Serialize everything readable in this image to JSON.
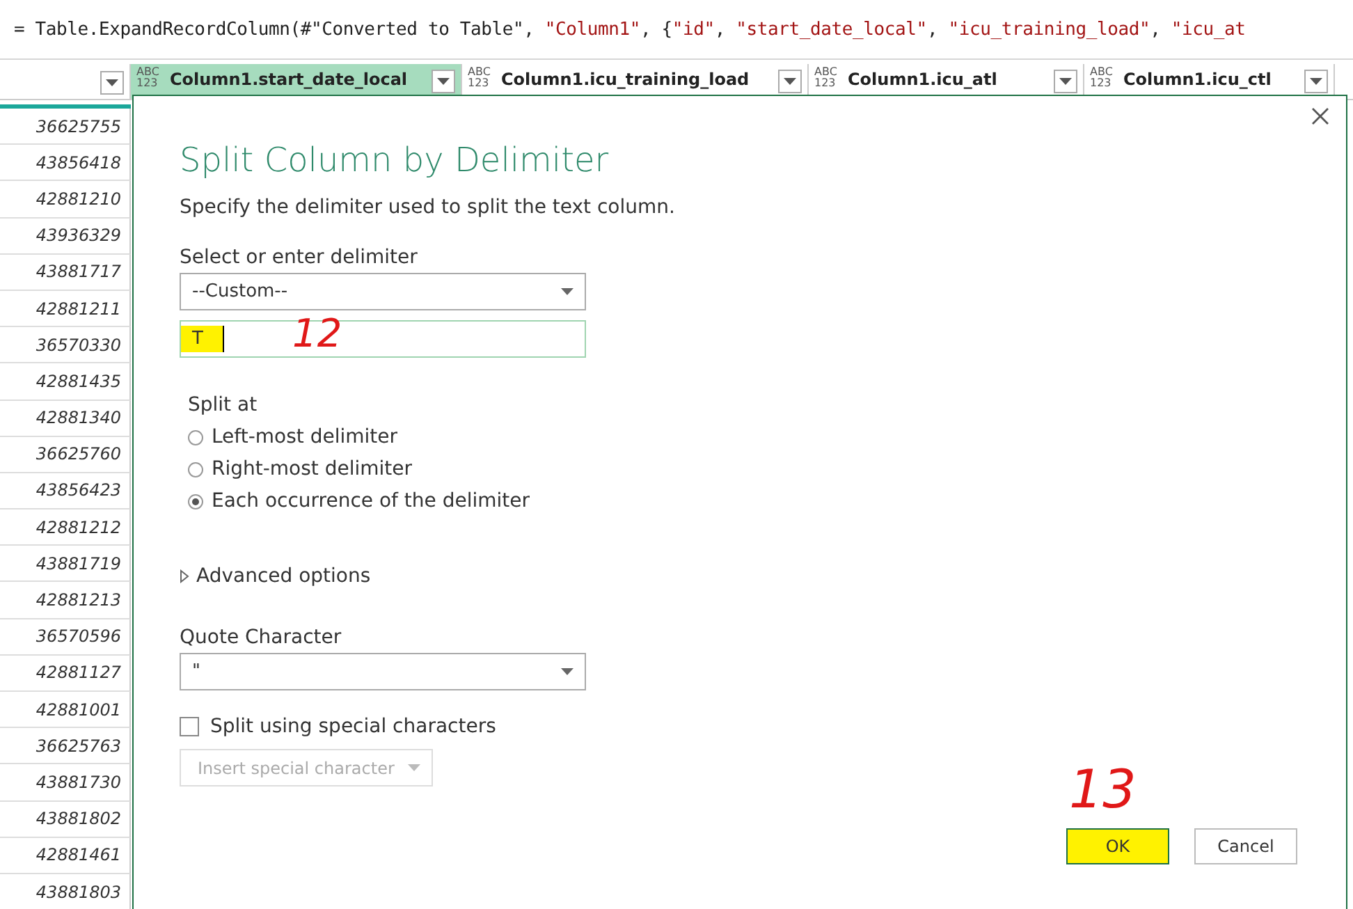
{
  "formula_bar": {
    "parts": [
      {
        "kind": "code",
        "text": "= Table.ExpandRecordColumn(#\"Converted to Table\", "
      },
      {
        "kind": "string",
        "text": "\"Column1\""
      },
      {
        "kind": "code",
        "text": ", {"
      },
      {
        "kind": "string",
        "text": "\"id\""
      },
      {
        "kind": "code",
        "text": ", "
      },
      {
        "kind": "string",
        "text": "\"start_date_local\""
      },
      {
        "kind": "code",
        "text": ", "
      },
      {
        "kind": "string",
        "text": "\"icu_training_load\""
      },
      {
        "kind": "code",
        "text": ", "
      },
      {
        "kind": "string",
        "text": "\"icu_at"
      }
    ]
  },
  "table": {
    "columns": [
      {
        "type": "ABC 123",
        "label": "Column1.start_date_local",
        "selected": true
      },
      {
        "type": "ABC 123",
        "label": "Column1.icu_training_load",
        "selected": false
      },
      {
        "type": "ABC 123",
        "label": "Column1.icu_atl",
        "selected": false
      },
      {
        "type": "ABC 123",
        "label": "Column1.icu_ctl",
        "selected": false
      }
    ],
    "id_column": [
      "36625755",
      "43856418",
      "42881210",
      "43936329",
      "43881717",
      "42881211",
      "36570330",
      "42881435",
      "42881340",
      "36625760",
      "43856423",
      "42881212",
      "43881719",
      "42881213",
      "36570596",
      "42881127",
      "42881001",
      "36625763",
      "43881730",
      "43881802",
      "42881461",
      "43881803"
    ]
  },
  "dialog": {
    "title": "Split Column by Delimiter",
    "description": "Specify the delimiter used to split the text column.",
    "delimiter_label": "Select or enter delimiter",
    "delimiter_select": "--Custom--",
    "delimiter_value": "T",
    "delimiter_highlighted": true,
    "delimiter_annotation": "12",
    "split_at_label": "Split at",
    "split_options": [
      {
        "label": "Left-most delimiter",
        "selected": false
      },
      {
        "label": "Right-most delimiter",
        "selected": false
      },
      {
        "label": "Each occurrence of the delimiter",
        "selected": true
      }
    ],
    "advanced_label": "Advanced options",
    "advanced_expanded": false,
    "quote_label": "Quote Character",
    "quote_value": "\"",
    "special_chars": {
      "label": "Split using special characters",
      "checked": false
    },
    "insert_button": {
      "label": "Insert special character",
      "disabled": true
    },
    "buttons": [
      {
        "label": "OK",
        "kind": "primary",
        "highlighted": true,
        "annotation": "13"
      },
      {
        "label": "Cancel",
        "kind": "secondary",
        "highlighted": false
      }
    ]
  }
}
